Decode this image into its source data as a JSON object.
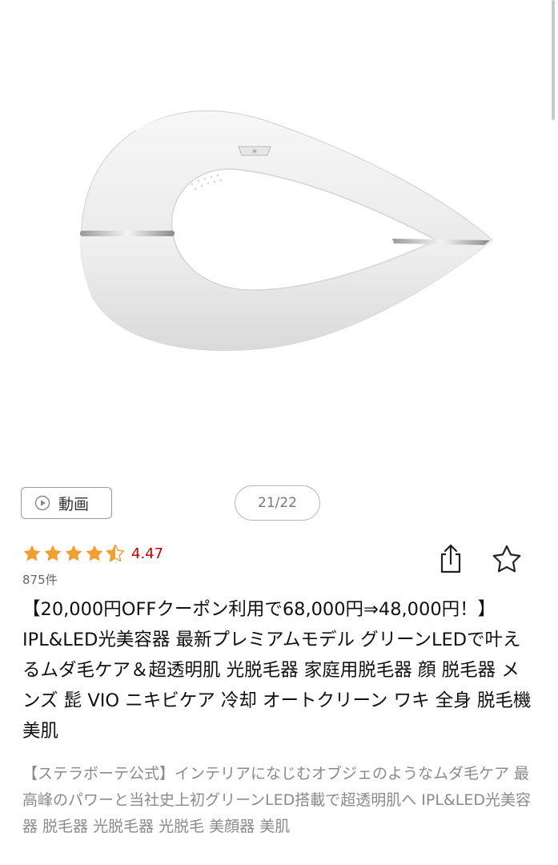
{
  "gallery": {
    "image_alt": "IPL&LED光美容器 本体画像",
    "current": "21/22"
  },
  "video_button": {
    "label": "動画",
    "icon": "play-icon"
  },
  "rating": {
    "stars": 4.5,
    "value": "4.47",
    "count": "875件",
    "color": "#f0a030"
  },
  "actions": {
    "share_icon": "share-icon",
    "favorite_icon": "star-outline-icon"
  },
  "product": {
    "title": "【20,000円OFFクーポン利用で68,000円⇒48,000円！】IPL&LED光美容器 最新プレミアムモデル グリーンLEDで叶えるムダ毛ケア＆超透明肌 光脱毛器 家庭用脱毛器 顔 脱毛器 メンズ 髭 VIO ニキビケア 冷却 オートクリーン ワキ 全身 脱毛機 美肌",
    "catch_copy": "【ステラボーテ公式】インテリアになじむオブジェのようなムダ毛ケア 最高峰のパワーと当社史上初グリーンLED搭載で超透明肌へ IPL&LED光美容器 脱毛器 光脱毛器 光脱毛 美顔器 美肌"
  }
}
